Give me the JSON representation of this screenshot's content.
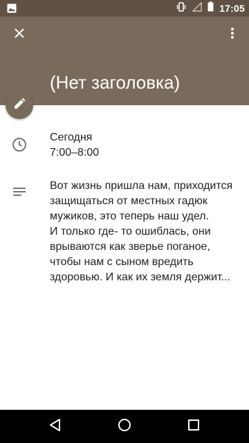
{
  "status_bar": {
    "time": "17:05",
    "icons": [
      "image-icon",
      "vibrate-icon",
      "signal-icon",
      "battery-icon"
    ]
  },
  "toolbar": {
    "close_icon": "close-icon",
    "more_icon": "more-vert-icon",
    "title": "(Нет заголовка)",
    "color": "#7a6a5b"
  },
  "edit_button": {
    "icon": "pencil-icon"
  },
  "event_time": {
    "day": "Сегодня",
    "range": "7:00–8:00"
  },
  "description": {
    "lines": [
      "Вот жизнь пришла нам, приходится",
      "защищаться от местных гадюк",
      "мужиков, это теперь наш удел.",
      "И только где- то ошиблась, они",
      "врываются как зверье поганое,",
      "чтобы нам с сыном вредить",
      "здоровью. И как их земля держит..."
    ]
  },
  "nav_bar": {
    "icons": [
      "back-icon",
      "home-icon",
      "recents-icon"
    ]
  }
}
